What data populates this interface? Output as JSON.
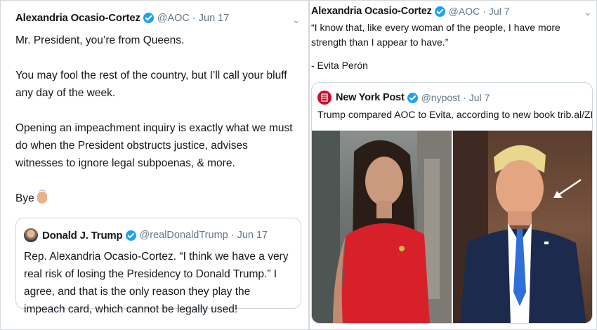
{
  "left_tweet": {
    "author_name": "Alexandria Ocasio-Cortez",
    "handle": "@AOC",
    "date": "Jun 17",
    "paragraphs": [
      "Mr. President, you’re from Queens.",
      "You may fool the rest of the country, but I’ll call your bluff any day of the week.",
      "Opening an impeachment inquiry is exactly what we must do when the President obstructs justice, advises witnesses to ignore legal subpoenas, & more.",
      "Bye"
    ],
    "quoted": {
      "author_name": "Donald J. Trump",
      "handle": "@realDonaldTrump",
      "date": "Jun 17",
      "text": "Rep. Alexandria Ocasio-Cortez. “I think we have a very real risk of losing the Presidency to Donald Trump.” I agree, and that is the only reason they play the impeach card, which cannot be legally used!"
    }
  },
  "right_tweet": {
    "author_name": "Alexandria Ocasio-Cortez",
    "handle": "@AOC",
    "date": "Jul 7",
    "quote_text": "“I know that, like every woman of the people, I have more strength than I appear to have.”",
    "attribution": "- Evita Perón",
    "quoted": {
      "author_name": "New York Post",
      "handle": "@nypost",
      "date": "Jul 7",
      "text": "Trump compared AOC to Evita, according to new book trib.al/ZReuOJE"
    }
  },
  "separator": "·",
  "icons": {
    "verified": "verified-badge-icon",
    "caret": "chevron-down-icon",
    "wave": "waving-hand-emoji",
    "nypost_logo": "nypost-logo-icon",
    "arrow": "white-arrow-annotation"
  },
  "colors": {
    "verified_blue": "#1da1f2",
    "meta_gray": "#657786",
    "border": "#ccd6dd",
    "red_dress": "#d8202a",
    "navy_suit": "#1c2a4d",
    "blue_tie": "#2f6fd6"
  }
}
